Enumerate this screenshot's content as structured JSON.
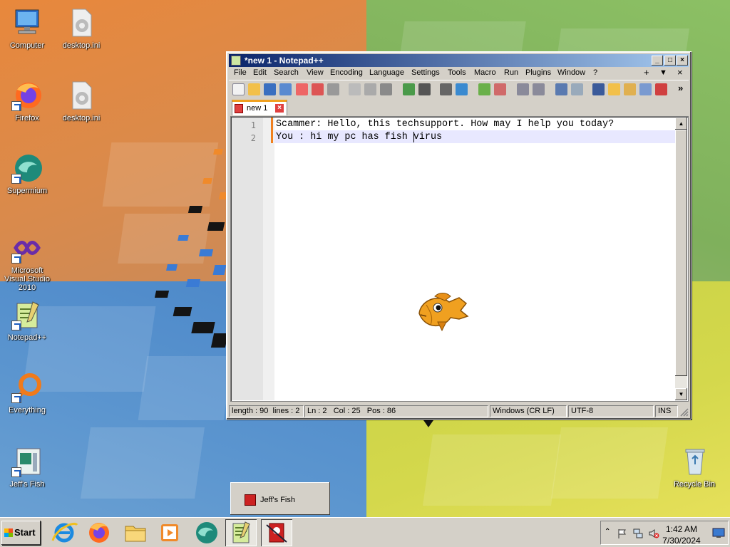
{
  "desktop": {
    "icons": [
      {
        "label": "Computer"
      },
      {
        "label": "desktop.ini"
      },
      {
        "label": "Firefox"
      },
      {
        "label": "desktop.ini"
      },
      {
        "label": "Supermium"
      },
      {
        "label": "Microsoft Visual Studio 2010"
      },
      {
        "label": "Notepad++"
      },
      {
        "label": "Everything"
      },
      {
        "label": "Jeff's Fish"
      },
      {
        "label": "Recycle Bin"
      }
    ]
  },
  "notepad": {
    "title": "*new 1 - Notepad++",
    "controls": {
      "minimize": "_",
      "maximize": "□",
      "close": "×"
    },
    "menu": [
      "File",
      "Edit",
      "Search",
      "View",
      "Encoding",
      "Language",
      "Settings",
      "Tools",
      "Macro",
      "Run",
      "Plugins",
      "Window",
      "?"
    ],
    "menu_right": {
      "plus": "+",
      "dropdown": "▼",
      "close": "×"
    },
    "toolbar_overflow": "»",
    "tab": {
      "label": "new 1",
      "close": "×"
    },
    "lines": [
      {
        "number": "1",
        "text": "Scammer: Hello, this techsupport. How may I help you today?"
      },
      {
        "number": "2",
        "text": "You : hi my pc has fish virus"
      }
    ],
    "status": {
      "length": "length : 90",
      "lines": "lines : 2",
      "ln": "Ln : 2",
      "col": "Col : 25",
      "pos": "Pos : 86",
      "eol": "Windows (CR LF)",
      "encoding": "UTF-8",
      "mode": "INS"
    }
  },
  "fish_window": {
    "label": "Jeff's Fish"
  },
  "taskbar": {
    "start_label": "Start",
    "apps": [
      "internet-explorer",
      "firefox",
      "file-explorer",
      "media-player",
      "supermium",
      "notepad-plus-plus",
      "jeffs-fish"
    ],
    "clock": {
      "time": "1:42 AM",
      "date": "7/30/2024"
    }
  },
  "colors": {
    "titlebar_start": "#0a246a",
    "titlebar_end": "#a6caf0",
    "current_line": "#e8e8ff",
    "modified_mark": "#f08020"
  }
}
